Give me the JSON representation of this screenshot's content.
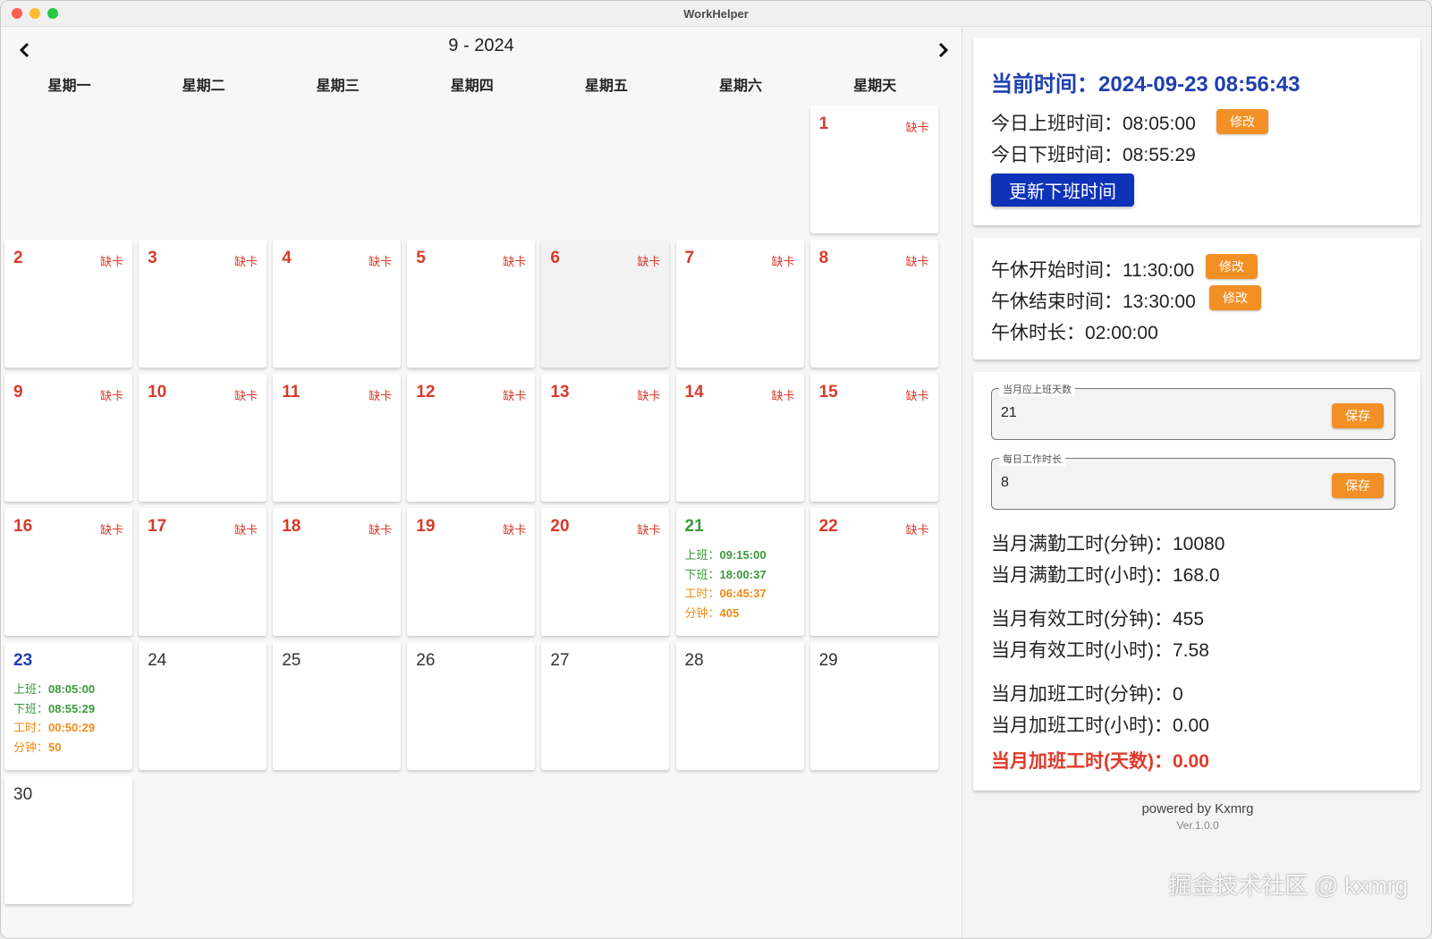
{
  "window": {
    "title": "WorkHelper"
  },
  "calendar": {
    "prev_icon": "chevron-left-icon",
    "next_icon": "chevron-right-icon",
    "month_label": "9 - 2024",
    "weekdays": [
      "星期一",
      "星期二",
      "星期三",
      "星期四",
      "星期五",
      "星期六",
      "星期天"
    ],
    "missing_label": "缺卡",
    "labels": {
      "start": "上班：",
      "end": "下班：",
      "hours": "工时：",
      "minutes": "分钟："
    },
    "days": [
      {
        "day": "1",
        "status": "missing"
      },
      {
        "day": "2",
        "status": "missing"
      },
      {
        "day": "3",
        "status": "missing"
      },
      {
        "day": "4",
        "status": "missing"
      },
      {
        "day": "5",
        "status": "missing"
      },
      {
        "day": "6",
        "status": "missing",
        "highlighted": true
      },
      {
        "day": "7",
        "status": "missing"
      },
      {
        "day": "8",
        "status": "missing"
      },
      {
        "day": "9",
        "status": "missing"
      },
      {
        "day": "10",
        "status": "missing"
      },
      {
        "day": "11",
        "status": "missing"
      },
      {
        "day": "12",
        "status": "missing"
      },
      {
        "day": "13",
        "status": "missing"
      },
      {
        "day": "14",
        "status": "missing"
      },
      {
        "day": "15",
        "status": "missing"
      },
      {
        "day": "16",
        "status": "missing"
      },
      {
        "day": "17",
        "status": "missing"
      },
      {
        "day": "18",
        "status": "missing"
      },
      {
        "day": "19",
        "status": "missing"
      },
      {
        "day": "20",
        "status": "missing"
      },
      {
        "day": "21",
        "status": "ok",
        "start": "09:15:00",
        "end": "18:00:37",
        "hours": "06:45:37",
        "minutes": "405"
      },
      {
        "day": "22",
        "status": "missing"
      },
      {
        "day": "23",
        "status": "today",
        "start": "08:05:00",
        "end": "08:55:29",
        "hours": "00:50:29",
        "minutes": "50"
      },
      {
        "day": "24",
        "status": "future"
      },
      {
        "day": "25",
        "status": "future"
      },
      {
        "day": "26",
        "status": "future"
      },
      {
        "day": "27",
        "status": "future"
      },
      {
        "day": "28",
        "status": "future"
      },
      {
        "day": "29",
        "status": "future"
      },
      {
        "day": "30",
        "status": "future"
      }
    ],
    "first_weekday_index": 6
  },
  "panel": {
    "current_time_label": "当前时间：",
    "current_time_value": "2024-09-23 08:56:43",
    "start_label": "今日上班时间：",
    "start_value": "08:05:00",
    "end_label": "今日下班时间：",
    "end_value": "08:55:29",
    "edit_label": "修改",
    "update_end_button": "更新下班时间",
    "lunch_start_label": "午休开始时间：",
    "lunch_start_value": "11:30:00",
    "lunch_end_label": "午休结束时间：",
    "lunch_end_value": "13:30:00",
    "lunch_duration_label": "午休时长：",
    "lunch_duration_value": "02:00:00",
    "workdays_field": {
      "legend": "当月应上班天数",
      "value": "21"
    },
    "daily_hours_field": {
      "legend": "每日工作时长",
      "value": "8"
    },
    "save_label": "保存",
    "stats": {
      "full_minutes_label": "当月满勤工时(分钟)：",
      "full_minutes_value": "10080",
      "full_hours_label": "当月满勤工时(小时)：",
      "full_hours_value": "168.0",
      "effective_minutes_label": "当月有效工时(分钟)：",
      "effective_minutes_value": "455",
      "effective_hours_label": "当月有效工时(小时)：",
      "effective_hours_value": "7.58",
      "overtime_minutes_label": "当月加班工时(分钟)：",
      "overtime_minutes_value": "0",
      "overtime_hours_label": "当月加班工时(小时)：",
      "overtime_hours_value": "0.00",
      "overtime_days_label": "当月加班工时(天数)：",
      "overtime_days_value": "0.00"
    },
    "footer_powered": "powered by Kxmrg",
    "footer_version": "Ver.1.0.0"
  },
  "watermark": "掘金技术社区 @ kxmrg",
  "colors": {
    "missing": "#d83a2a",
    "ok": "#3a9a3a",
    "today": "#1f3fb0",
    "accent_orange": "#f39025",
    "primary_blue": "#0e33b8"
  }
}
